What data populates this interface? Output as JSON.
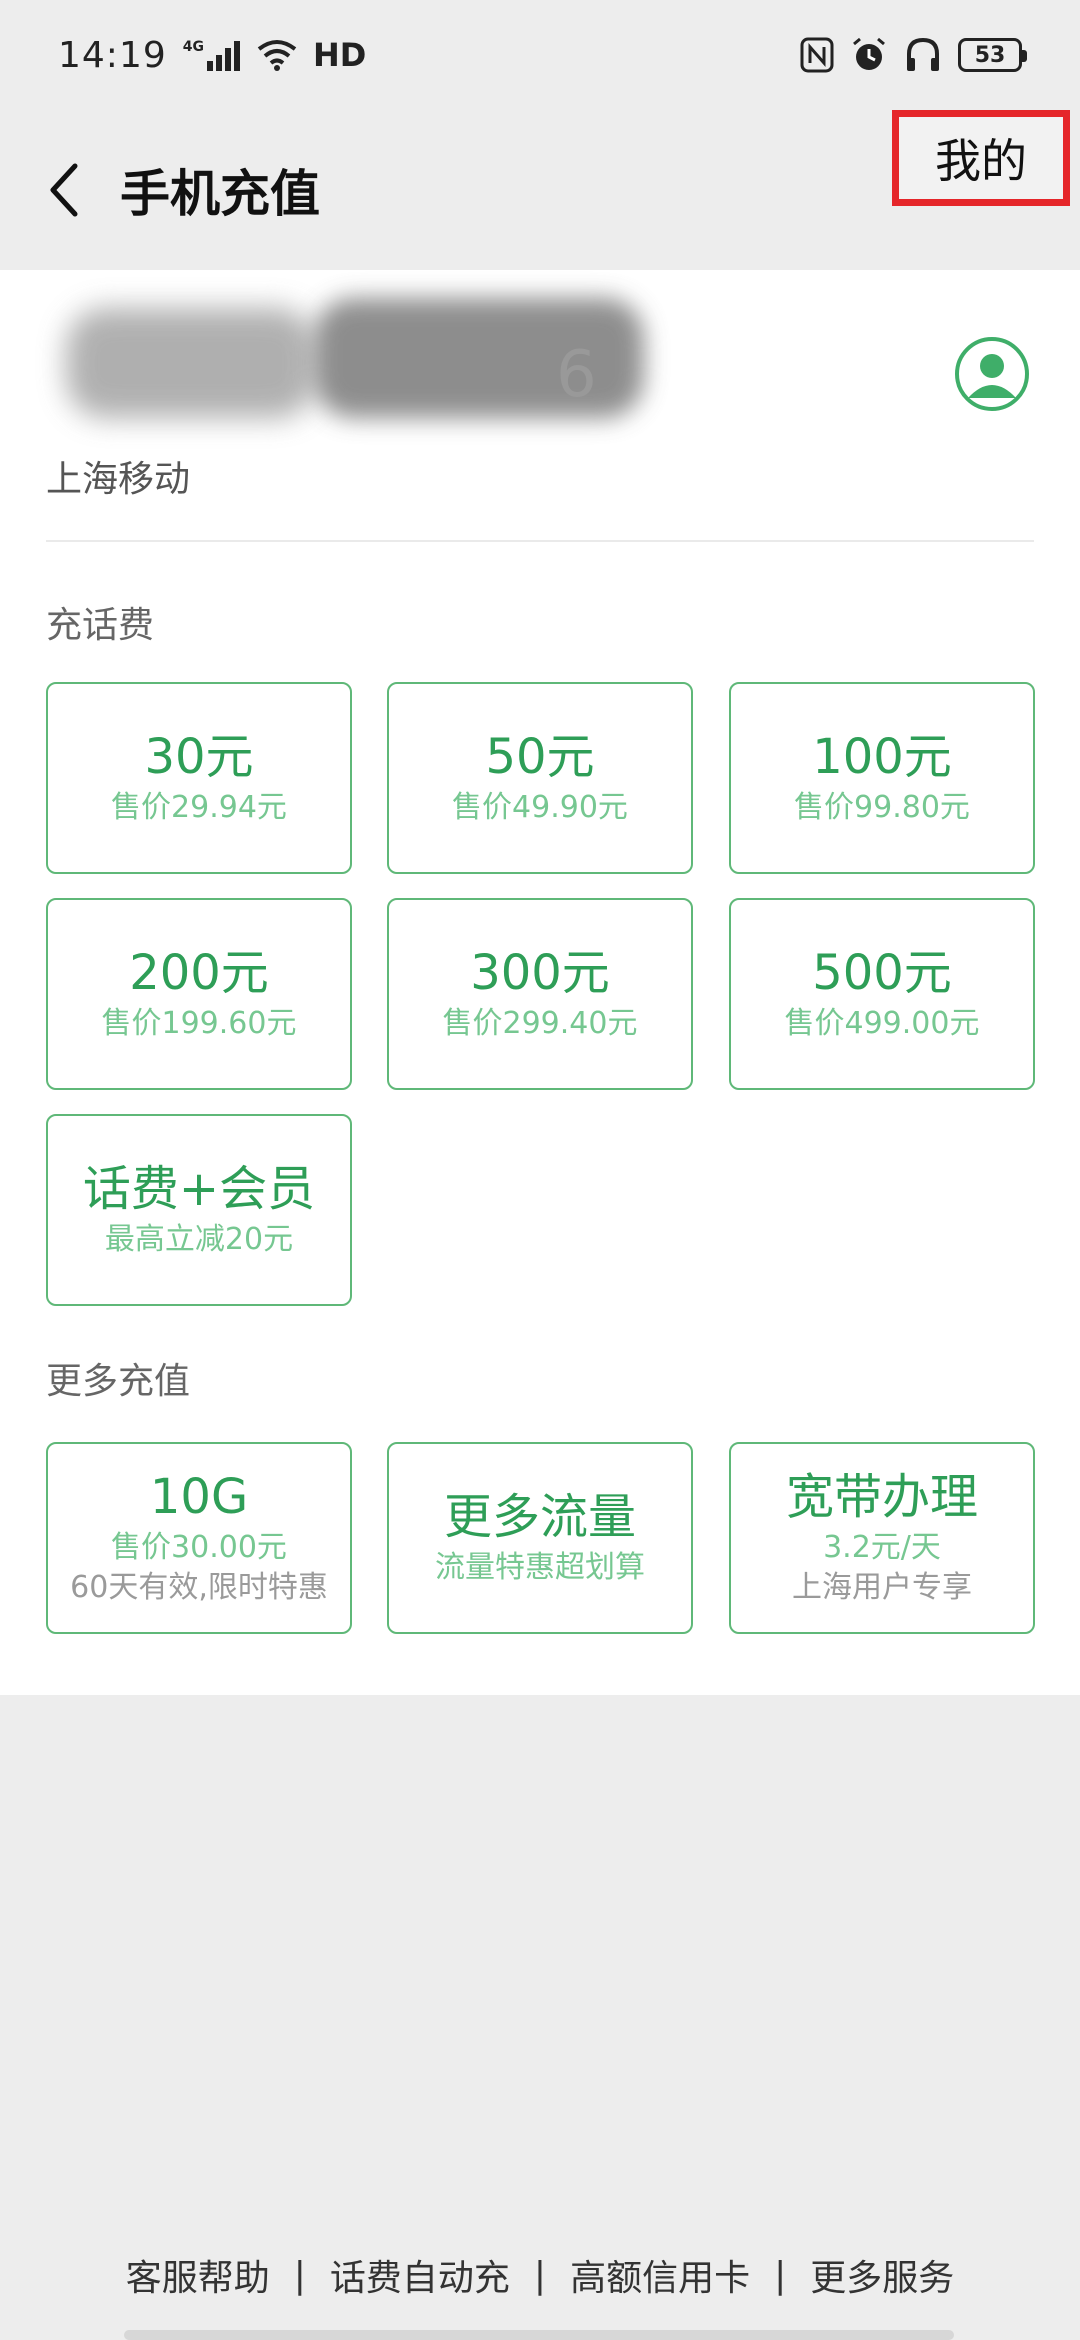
{
  "status_bar": {
    "time": "14:19",
    "network": "4G",
    "hd": "HD",
    "battery": "53"
  },
  "header": {
    "title": "手机充值",
    "mine_label": "我的"
  },
  "account": {
    "phone_tail": "6",
    "carrier": "上海移动"
  },
  "sections": {
    "recharge_label": "充话费",
    "more_label": "更多充值"
  },
  "recharge_tiles": [
    {
      "main": "30元",
      "sub": "售价29.94元"
    },
    {
      "main": "50元",
      "sub": "售价49.90元"
    },
    {
      "main": "100元",
      "sub": "售价99.80元"
    },
    {
      "main": "200元",
      "sub": "售价199.60元"
    },
    {
      "main": "300元",
      "sub": "售价299.40元"
    },
    {
      "main": "500元",
      "sub": "售价499.00元"
    },
    {
      "main": "话费+会员",
      "sub": "最高立减20元"
    }
  ],
  "more_tiles": [
    {
      "main": "10G",
      "sub": "售价30.00元",
      "sub2": "60天有效,限时特惠"
    },
    {
      "main": "更多流量",
      "sub": "流量特惠超划算"
    },
    {
      "main": "宽带办理",
      "sub": "3.2元/天",
      "sub2": "上海用户专享"
    }
  ],
  "footer": {
    "links": [
      "客服帮助",
      "话费自动充",
      "高额信用卡",
      "更多服务"
    ],
    "separator": "|"
  },
  "colors": {
    "accent_green": "#2E9E57",
    "tile_border": "#5FB878",
    "highlight_red": "#E5262A"
  }
}
